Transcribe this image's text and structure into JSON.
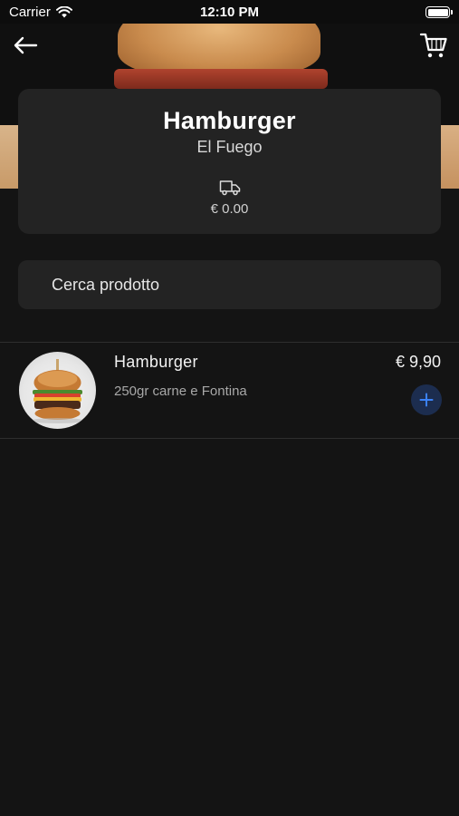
{
  "status_bar": {
    "carrier": "Carrier",
    "time": "12:10 PM"
  },
  "header": {
    "back_icon": "arrow-left-icon",
    "cart_icon": "shopping-cart-icon"
  },
  "restaurant": {
    "category": "Hamburger",
    "name": "El Fuego",
    "delivery_icon": "truck-icon",
    "delivery_cost": "€ 0.00"
  },
  "search": {
    "placeholder": "Cerca prodotto",
    "value": ""
  },
  "products": [
    {
      "name": "Hamburger",
      "description": "250gr carne e Fontina",
      "price": "€ 9,90",
      "add_icon": "plus-icon"
    }
  ],
  "colors": {
    "background": "#141414",
    "card": "#232323",
    "add_button_bg": "#1c2d4f",
    "add_button_icon": "#3b82f6"
  }
}
